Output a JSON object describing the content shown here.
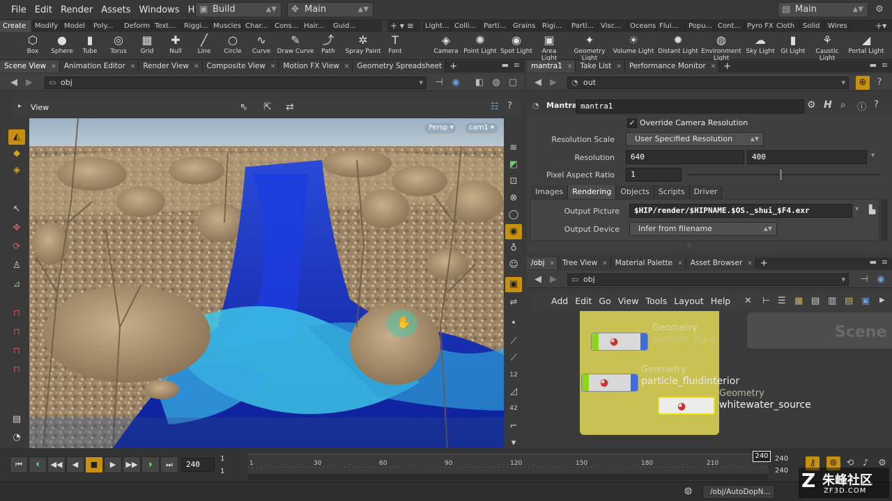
{
  "menubar": {
    "items": [
      "File",
      "Edit",
      "Render",
      "Assets",
      "Windows",
      "Help"
    ],
    "desktop": "Build",
    "network": "Main",
    "right_desktop": "Main"
  },
  "shelf_left": {
    "tabs": [
      "Create",
      "Modify",
      "Model",
      "Poly...",
      "Deform",
      "Text...",
      "Riggi...",
      "Muscles",
      "Char...",
      "Cons...",
      "Hair...",
      "Guid..."
    ],
    "tools": [
      {
        "label": "Box",
        "icon": "⬡"
      },
      {
        "label": "Sphere",
        "icon": "●"
      },
      {
        "label": "Tube",
        "icon": "▮"
      },
      {
        "label": "Torus",
        "icon": "◎"
      },
      {
        "label": "Grid",
        "icon": "▦"
      },
      {
        "label": "Null",
        "icon": "✚"
      },
      {
        "label": "Line",
        "icon": "╱"
      },
      {
        "label": "Circle",
        "icon": "○"
      },
      {
        "label": "Curve",
        "icon": "∿"
      },
      {
        "label": "Draw Curve",
        "icon": "✎"
      },
      {
        "label": "Path",
        "icon": "⤴"
      },
      {
        "label": "Spray Paint",
        "icon": "✲"
      },
      {
        "label": "Font",
        "icon": "T"
      }
    ]
  },
  "shelf_right": {
    "tabs": [
      "Light...",
      "Colli...",
      "Parti...",
      "Grains",
      "Rigi...",
      "Parti...",
      "Visc...",
      "Oceans",
      "Flui...",
      "Popu...",
      "Cont...",
      "Pyro FX",
      "Cloth",
      "Solid",
      "Wires"
    ],
    "tools": [
      {
        "label": "Camera",
        "icon": "◈"
      },
      {
        "label": "Point Light",
        "icon": "✺"
      },
      {
        "label": "Spot Light",
        "icon": "◉"
      },
      {
        "label": "Area Light",
        "icon": "▣"
      },
      {
        "label": "Geometry Light",
        "icon": "✦"
      },
      {
        "label": "Volume Light",
        "icon": "☀"
      },
      {
        "label": "Distant Light",
        "icon": "✹"
      },
      {
        "label": "Environment Light",
        "icon": "◍"
      },
      {
        "label": "Sky Light",
        "icon": "☁"
      },
      {
        "label": "GI Light",
        "icon": "▮"
      },
      {
        "label": "Caustic Light",
        "icon": "⚘"
      },
      {
        "label": "Portal Light",
        "icon": "◢"
      }
    ]
  },
  "left_pane": {
    "tabs": [
      "Scene View",
      "Animation Editor",
      "Render View",
      "Composite View",
      "Motion FX View",
      "Geometry Spreadsheet"
    ],
    "path": "obj",
    "view_label": "View",
    "camera_menu": "Persp",
    "cam_name": "cam1"
  },
  "param_pane": {
    "tabs": [
      "mantra1",
      "Take List",
      "Performance Monitor"
    ],
    "path": "out",
    "node_type": "Mantra",
    "node_name": "mantra1",
    "override_label": "Override Camera Resolution",
    "resolution_scale_label": "Resolution Scale",
    "resolution_scale_value": "User Specified Resolution",
    "resolution_label": "Resolution",
    "res_x": "640",
    "res_y": "400",
    "pixel_aspect_label": "Pixel Aspect Ratio",
    "pixel_aspect_value": "1",
    "subtabs": [
      "Images",
      "Rendering",
      "Objects",
      "Scripts",
      "Driver"
    ],
    "output_picture_label": "Output Picture",
    "output_picture_value": "$HIP/render/$HIPNAME.$OS._shui_$F4.exr",
    "output_device_label": "Output Device",
    "output_device_value": "Infer from filename"
  },
  "network_pane": {
    "tabs": [
      "/obj",
      "Tree View",
      "Material Palette",
      "Asset Browser"
    ],
    "path": "obj",
    "menu": [
      "Add",
      "Edit",
      "Go",
      "View",
      "Tools",
      "Layout",
      "Help"
    ],
    "scene_watermark": "Scene",
    "nodes": [
      {
        "type": "Geometry",
        "name": "particle_fluid"
      },
      {
        "type": "Geometry",
        "name": "particle_fluidinterior"
      },
      {
        "type": "Geometry",
        "name": "whitewater_source"
      }
    ]
  },
  "timeline": {
    "current_frame": "240",
    "start": "1",
    "start2": "1",
    "ticks": [
      "1",
      "30",
      "60",
      "90",
      "120",
      "150",
      "180",
      "210"
    ],
    "end_frame": "240",
    "end_a": "240",
    "end_b": "240"
  },
  "statusbar": {
    "path": "/obj/AutoDopN..."
  },
  "watermark": {
    "brand": "朱峰社区",
    "url": "ZF3D.COM"
  }
}
